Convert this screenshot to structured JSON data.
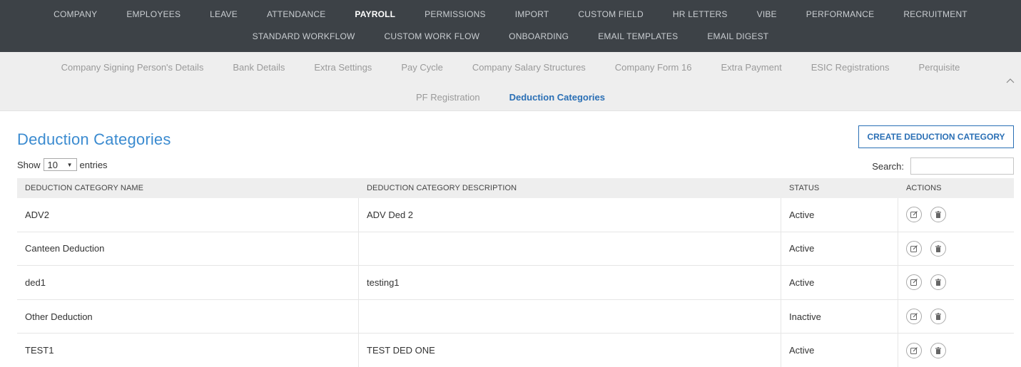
{
  "top_nav": {
    "row1": [
      "COMPANY",
      "EMPLOYEES",
      "LEAVE",
      "ATTENDANCE",
      "PAYROLL",
      "PERMISSIONS",
      "IMPORT",
      "CUSTOM FIELD",
      "HR LETTERS",
      "VIBE",
      "PERFORMANCE",
      "RECRUITMENT"
    ],
    "row2": [
      "STANDARD WORKFLOW",
      "CUSTOM WORK FLOW",
      "ONBOARDING",
      "EMAIL TEMPLATES",
      "EMAIL DIGEST"
    ],
    "active": "PAYROLL"
  },
  "sub_nav": {
    "row1": [
      "Company Signing Person's Details",
      "Bank Details",
      "Extra Settings",
      "Pay Cycle",
      "Company Salary Structures",
      "Company Form 16",
      "Extra Payment",
      "ESIC Registrations",
      "Perquisite"
    ],
    "row2": [
      "PF Registration",
      "Deduction Categories"
    ],
    "active": "Deduction Categories",
    "collapse_icon": "chevron-up-icon"
  },
  "page": {
    "title": "Deduction Categories",
    "create_button": "CREATE DEDUCTION CATEGORY"
  },
  "controls": {
    "show_label": "Show",
    "entries_value": "10",
    "entries_label": "entries",
    "search_label": "Search:",
    "search_value": ""
  },
  "table": {
    "columns": [
      "DEDUCTION CATEGORY NAME",
      "DEDUCTION CATEGORY DESCRIPTION",
      "STATUS",
      "ACTIONS"
    ],
    "rows": [
      {
        "name": "ADV2",
        "description": "ADV Ded 2",
        "status": "Active"
      },
      {
        "name": "Canteen Deduction",
        "description": "",
        "status": "Active"
      },
      {
        "name": "ded1",
        "description": "testing1",
        "status": "Active"
      },
      {
        "name": "Other Deduction",
        "description": "",
        "status": "Inactive"
      },
      {
        "name": "TEST1",
        "description": "TEST DED ONE",
        "status": "Active"
      }
    ],
    "action_icons": [
      "edit-icon",
      "delete-icon"
    ]
  },
  "colors": {
    "top_nav_bg": "#3d4247",
    "sub_nav_bg": "#eeeeee",
    "accent": "#2a6fb5",
    "title": "#3b8bd0"
  }
}
